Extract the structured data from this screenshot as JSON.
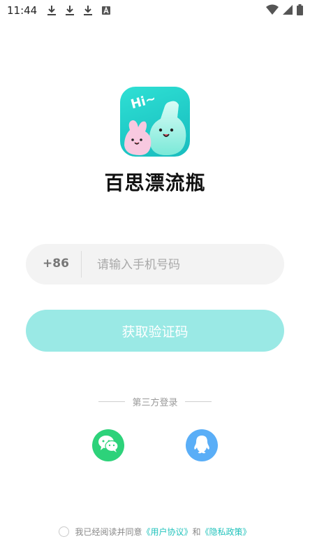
{
  "status_bar": {
    "time": "11:44",
    "left_icons": [
      "download-icon",
      "download-icon",
      "download-icon",
      "a-icon"
    ],
    "right_icons": [
      "wifi-icon",
      "signal-icon",
      "battery-icon"
    ]
  },
  "app": {
    "logo_icon": "app-logo-icon",
    "logo_text": "Hi~",
    "name": "百思漂流瓶"
  },
  "phone": {
    "country_code": "+86",
    "placeholder": "请输入手机号码",
    "value": ""
  },
  "actions": {
    "get_code_label": "获取验证码"
  },
  "third_party": {
    "label": "第三方登录",
    "options": [
      "wechat-icon",
      "qq-icon"
    ]
  },
  "agreement": {
    "prefix": "我已经阅读并同意",
    "user_agreement": "《用户协议》",
    "conj": "和",
    "privacy_policy": "《隐私政策》"
  },
  "colors": {
    "primary": "#9ae9e5",
    "link": "#22c3bc",
    "wechat": "#2dd27a",
    "qq": "#5aaef7"
  }
}
